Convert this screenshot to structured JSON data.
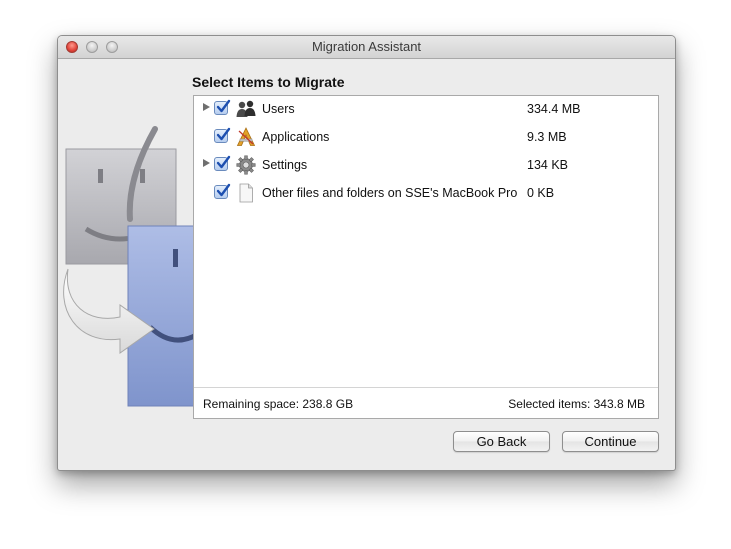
{
  "window": {
    "title": "Migration Assistant"
  },
  "heading": "Select Items to Migrate",
  "items": [
    {
      "name": "Users",
      "size": "334.4 MB",
      "checked": true,
      "expandable": true,
      "icon": "users-icon"
    },
    {
      "name": "Applications",
      "size": "9.3 MB",
      "checked": true,
      "expandable": false,
      "icon": "applications-icon"
    },
    {
      "name": "Settings",
      "size": "134 KB",
      "checked": true,
      "expandable": true,
      "icon": "settings-gear-icon"
    },
    {
      "name": "Other files and folders on SSE's MacBook Pro",
      "size": "0 KB",
      "checked": true,
      "expandable": false,
      "icon": "document-icon"
    }
  ],
  "status": {
    "remaining_space": "Remaining space: 238.8 GB",
    "selected_items": "Selected items: 343.8 MB"
  },
  "buttons": {
    "back_label": "Go Back",
    "continue_label": "Continue"
  },
  "colors": {
    "checkbox_blue": "#2a62c8",
    "finder_blue": "#8da2d6",
    "finder_gray": "#b8b8be"
  }
}
